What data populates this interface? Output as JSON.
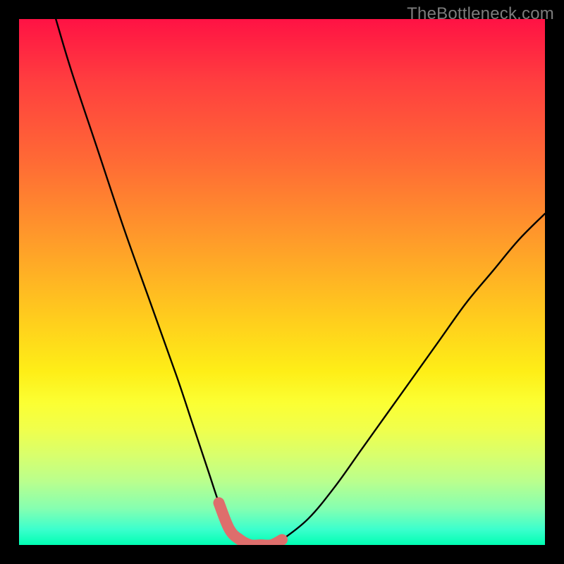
{
  "attribution": "TheBottleneck.com",
  "chart_data": {
    "type": "line",
    "title": "",
    "xlabel": "",
    "ylabel": "",
    "xlim": [
      0,
      100
    ],
    "ylim": [
      0,
      100
    ],
    "series": [
      {
        "name": "bottleneck-curve",
        "x": [
          7,
          10,
          15,
          20,
          25,
          30,
          33,
          36,
          38,
          40,
          42,
          44,
          46,
          48,
          50,
          55,
          60,
          65,
          70,
          75,
          80,
          85,
          90,
          95,
          100
        ],
        "values": [
          100,
          90,
          75,
          60,
          46,
          32,
          23,
          14,
          8,
          3,
          1,
          0,
          0,
          0,
          1,
          5,
          11,
          18,
          25,
          32,
          39,
          46,
          52,
          58,
          63
        ]
      },
      {
        "name": "highlight-band",
        "x": [
          38,
          40,
          42,
          44,
          46,
          48,
          50
        ],
        "values": [
          8,
          3,
          1,
          0,
          0,
          0,
          1
        ]
      }
    ],
    "gradient_stops": [
      {
        "pos": 0,
        "color": "#ff1244"
      },
      {
        "pos": 12,
        "color": "#ff3f3f"
      },
      {
        "pos": 27,
        "color": "#ff6a35"
      },
      {
        "pos": 42,
        "color": "#ff9b2a"
      },
      {
        "pos": 57,
        "color": "#ffcd1d"
      },
      {
        "pos": 67,
        "color": "#feee17"
      },
      {
        "pos": 73,
        "color": "#fbff33"
      },
      {
        "pos": 78,
        "color": "#f0ff4c"
      },
      {
        "pos": 83,
        "color": "#d8ff6d"
      },
      {
        "pos": 88,
        "color": "#b9ff8e"
      },
      {
        "pos": 93,
        "color": "#86ffb0"
      },
      {
        "pos": 97,
        "color": "#3cffcd"
      },
      {
        "pos": 100,
        "color": "#00ffb3"
      }
    ],
    "colors": {
      "curve": "#000000",
      "highlight": "#de6e6c",
      "background_outer": "#000000"
    }
  }
}
